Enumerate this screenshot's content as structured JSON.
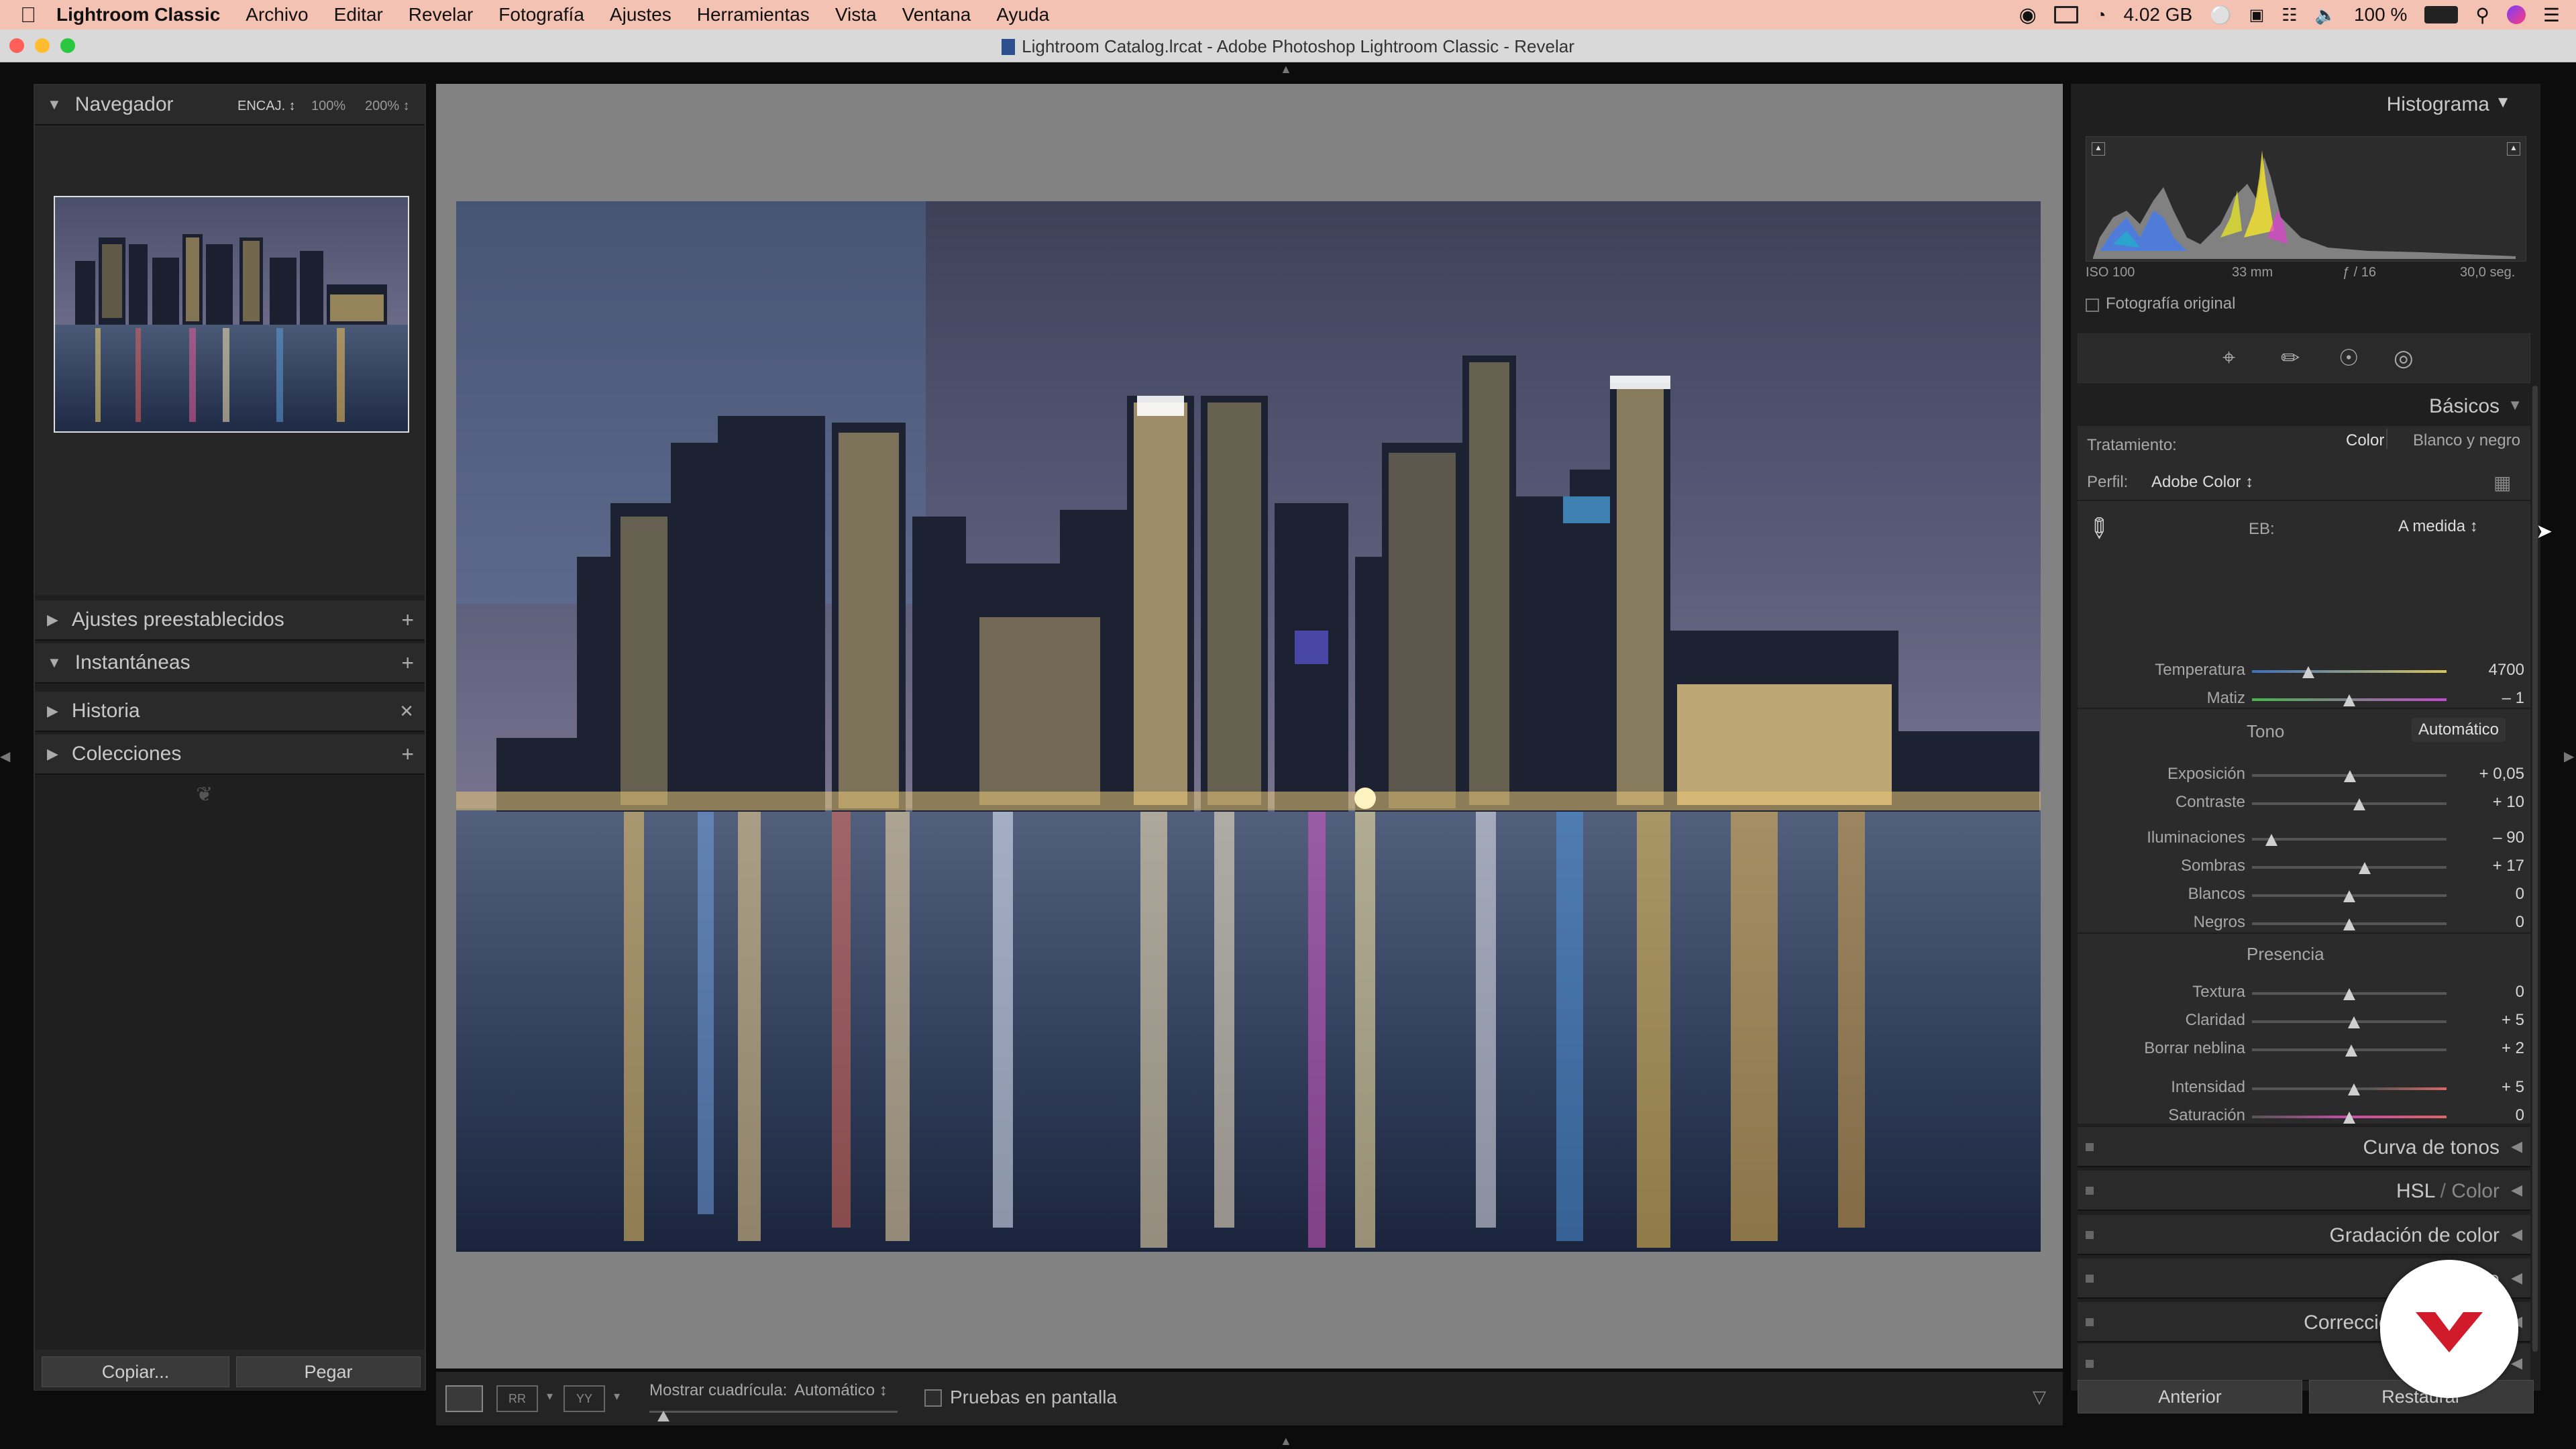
{
  "menubar": {
    "app": "Lightroom Classic",
    "items": [
      "Archivo",
      "Editar",
      "Revelar",
      "Fotografía",
      "Ajustes",
      "Herramientas",
      "Vista",
      "Ventana",
      "Ayuda"
    ],
    "memory": "4.02 GB",
    "battery": "100 %"
  },
  "window": {
    "title": "Lightroom Catalog.lrcat - Adobe Photoshop Lightroom Classic - Revelar"
  },
  "navigator": {
    "title": "Navegador",
    "zoom_fit": "ENCAJ.",
    "zoom_100": "100%",
    "zoom_200": "200%"
  },
  "left_sections": {
    "presets": "Ajustes preestablecidos",
    "snapshots": "Instantáneas",
    "history": "Historia",
    "collections": "Colecciones"
  },
  "left_buttons": {
    "copy": "Copiar...",
    "paste": "Pegar"
  },
  "toolbar": {
    "grid_label": "Mostrar cuadrícula:",
    "grid_value": "Automático",
    "softproof": "Pruebas en pantalla"
  },
  "histogram": {
    "title": "Histograma",
    "iso": "ISO 100",
    "focal": "33 mm",
    "aperture": "ƒ / 16",
    "shutter": "30,0 seg.",
    "original": "Fotografía original"
  },
  "basic": {
    "title": "Básicos",
    "treatment_label": "Tratamiento:",
    "treatment_color": "Color",
    "treatment_bw": "Blanco y negro",
    "profile_label": "Perfil:",
    "profile_value": "Adobe Color",
    "wb_label": "EB:",
    "wb_value": "A medida",
    "tone_label": "Tono",
    "auto": "Automático",
    "presence_label": "Presencia",
    "sliders": [
      {
        "label": "Temperatura",
        "value": "4700",
        "pos": 0.29
      },
      {
        "label": "Matiz",
        "value": "– 1",
        "pos": 0.5
      },
      {
        "label": "Exposición",
        "value": "+ 0,05",
        "pos": 0.505
      },
      {
        "label": "Contraste",
        "value": "+ 10",
        "pos": 0.55
      },
      {
        "label": "Iluminaciones",
        "value": "– 90",
        "pos": 0.1
      },
      {
        "label": "Sombras",
        "value": "+ 17",
        "pos": 0.58
      },
      {
        "label": "Blancos",
        "value": "0",
        "pos": 0.5
      },
      {
        "label": "Negros",
        "value": "0",
        "pos": 0.5
      },
      {
        "label": "Textura",
        "value": "0",
        "pos": 0.5
      },
      {
        "label": "Claridad",
        "value": "+ 5",
        "pos": 0.525
      },
      {
        "label": "Borrar neblina",
        "value": "+ 2",
        "pos": 0.51
      },
      {
        "label": "Intensidad",
        "value": "+ 5",
        "pos": 0.525
      },
      {
        "label": "Saturación",
        "value": "0",
        "pos": 0.5
      }
    ]
  },
  "right_sections": {
    "tone_curve": "Curva de tonos",
    "hsl": "HSL",
    "hsl_color": "Color",
    "color_grading": "Gradación de color",
    "detail": "Detalle",
    "lens": "Correcciones de lente"
  },
  "right_buttons": {
    "previous": "Anterior",
    "reset": "Restaurar"
  },
  "colors": {
    "menubar": "#f4c2b2",
    "panel": "#1f1f1f",
    "center": "#828282",
    "badge": "#d11a2a"
  }
}
